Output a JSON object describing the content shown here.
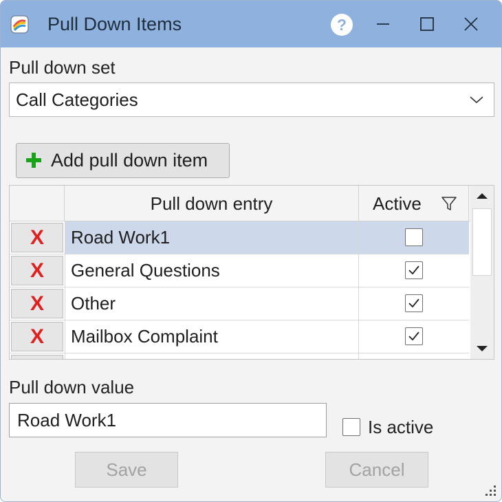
{
  "window": {
    "title": "Pull Down Items",
    "help_label": "?",
    "accent_color": "#8eb1dd"
  },
  "icons": {
    "app": "app-palette-icon",
    "minimize": "minimize-icon",
    "maximize": "maximize-icon",
    "close": "close-icon",
    "add": "plus-icon",
    "delete": "delete-x-icon",
    "filter": "filter-icon",
    "dropdown": "chevron-down-icon"
  },
  "pulldown_set": {
    "label": "Pull down set",
    "selected": "Call Categories"
  },
  "toolbar": {
    "add_label": "Add pull down item"
  },
  "grid": {
    "columns": [
      "",
      "Pull down entry",
      "Active"
    ],
    "delete_symbol": "X",
    "rows": [
      {
        "entry": "Road Work1",
        "active": false,
        "selected": true
      },
      {
        "entry": "General Questions",
        "active": true,
        "selected": false
      },
      {
        "entry": "Other",
        "active": true,
        "selected": false
      },
      {
        "entry": "Mailbox Complaint",
        "active": true,
        "selected": false
      }
    ]
  },
  "editor": {
    "value_label": "Pull down value",
    "value": "Road Work1",
    "is_active_label": "Is active",
    "is_active": false
  },
  "buttons": {
    "save_label": "Save",
    "cancel_label": "Cancel"
  }
}
